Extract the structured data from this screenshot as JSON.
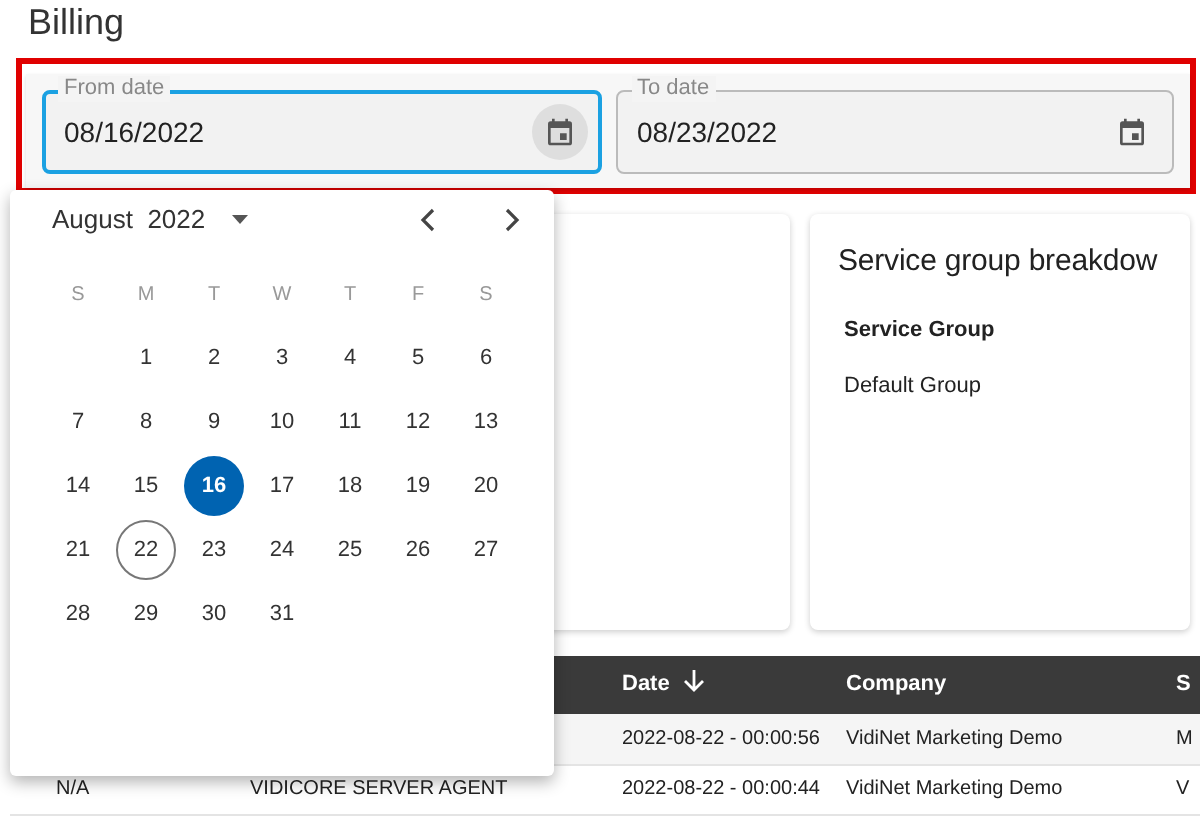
{
  "page": {
    "title": "Billing"
  },
  "filters": [
    {
      "label": "From date",
      "value": "08/16/2022",
      "focused": true,
      "icon_hover": true
    },
    {
      "label": "To date",
      "value": "08/23/2022",
      "focused": false,
      "icon_hover": false
    }
  ],
  "calendar": {
    "month": "August",
    "year": "2022",
    "weekdays": [
      "S",
      "M",
      "T",
      "W",
      "T",
      "F",
      "S"
    ],
    "weeks": [
      [
        {
          "label": "1",
          "selected": false,
          "today": false
        },
        {
          "label": "2",
          "selected": false,
          "today": false
        },
        {
          "label": "3",
          "selected": false,
          "today": false
        },
        {
          "label": "4",
          "selected": false,
          "today": false
        },
        {
          "label": "5",
          "selected": false,
          "today": false
        },
        {
          "label": "6",
          "selected": false,
          "today": false
        }
      ],
      [
        {
          "label": "7",
          "selected": false,
          "today": false
        },
        {
          "label": "8",
          "selected": false,
          "today": false
        },
        {
          "label": "9",
          "selected": false,
          "today": false
        },
        {
          "label": "10",
          "selected": false,
          "today": false
        },
        {
          "label": "11",
          "selected": false,
          "today": false
        },
        {
          "label": "12",
          "selected": false,
          "today": false
        },
        {
          "label": "13",
          "selected": false,
          "today": false
        }
      ],
      [
        {
          "label": "14",
          "selected": false,
          "today": false
        },
        {
          "label": "15",
          "selected": false,
          "today": false
        },
        {
          "label": "16",
          "selected": true,
          "today": false
        },
        {
          "label": "17",
          "selected": false,
          "today": false
        },
        {
          "label": "18",
          "selected": false,
          "today": false
        },
        {
          "label": "19",
          "selected": false,
          "today": false
        },
        {
          "label": "20",
          "selected": false,
          "today": false
        }
      ],
      [
        {
          "label": "21",
          "selected": false,
          "today": false
        },
        {
          "label": "22",
          "selected": false,
          "today": true
        },
        {
          "label": "23",
          "selected": false,
          "today": false
        },
        {
          "label": "24",
          "selected": false,
          "today": false
        },
        {
          "label": "25",
          "selected": false,
          "today": false
        },
        {
          "label": "26",
          "selected": false,
          "today": false
        },
        {
          "label": "27",
          "selected": false,
          "today": false
        }
      ],
      [
        {
          "label": "28",
          "selected": false,
          "today": false
        },
        {
          "label": "29",
          "selected": false,
          "today": false
        },
        {
          "label": "30",
          "selected": false,
          "today": false
        },
        {
          "label": "31",
          "selected": false,
          "today": false
        }
      ]
    ]
  },
  "service_group_card": {
    "title": "Service group breakdow",
    "column": "Service Group",
    "rows": [
      "Default Group"
    ]
  },
  "table": {
    "columns": [
      null,
      null,
      {
        "label": "Date",
        "sorted": true
      },
      {
        "label": "Company"
      },
      {
        "label": "S"
      }
    ],
    "rows": [
      [
        null,
        null,
        "2022-08-22 - 00:00:56",
        "VidiNet Marketing Demo",
        "M"
      ],
      [
        "N/A",
        "VIDICORE SERVER AGENT",
        "2022-08-22 - 00:00:44",
        "VidiNet Marketing Demo",
        "V"
      ]
    ]
  }
}
